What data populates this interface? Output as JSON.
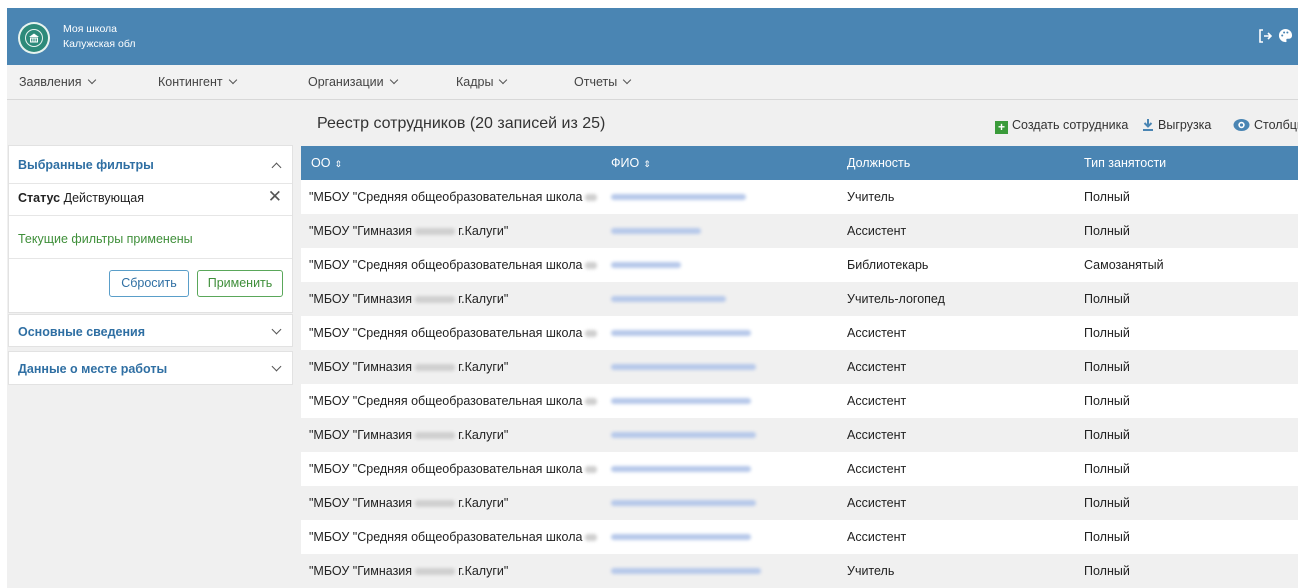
{
  "header": {
    "org_name": "Моя школа",
    "region": "Калужская обл"
  },
  "menu": [
    "Заявления",
    "Контингент",
    "Организации",
    "Кадры",
    "Отчеты"
  ],
  "filters": {
    "selected_title": "Выбранные фильтры",
    "status_label": "Статус",
    "status_value": "Действующая",
    "applied_text": "Текущие фильтры применены",
    "reset_label": "Сбросить",
    "apply_label": "Применить",
    "section_basic": "Основные сведения",
    "section_work": "Данные о месте работы"
  },
  "registry": {
    "title": "Реестр сотрудников (20 записей из 25)",
    "create_label": "Создать сотрудника",
    "export_label": "Выгрузка",
    "columns_label": "Столбцы"
  },
  "table": {
    "headers": [
      "ОО",
      "ФИО",
      "Должность",
      "Тип занятости"
    ],
    "rows": [
      {
        "org_prefix": "\"МБОУ \"Средняя общеобразовательная школа",
        "org_suffix": "",
        "position": "Учитель",
        "employment": "Полный"
      },
      {
        "org_prefix": "\"МБОУ \"Гимназия",
        "org_suffix": "г.Калуги\"",
        "position": "Ассистент",
        "employment": "Полный"
      },
      {
        "org_prefix": "\"МБОУ \"Средняя общеобразовательная школа",
        "org_suffix": "",
        "position": "Библиотекарь",
        "employment": "Самозанятый"
      },
      {
        "org_prefix": "\"МБОУ \"Гимназия",
        "org_suffix": "г.Калуги\"",
        "position": "Учитель-логопед",
        "employment": "Полный"
      },
      {
        "org_prefix": "\"МБОУ \"Средняя общеобразовательная школа",
        "org_suffix": "",
        "position": "Ассистент",
        "employment": "Полный"
      },
      {
        "org_prefix": "\"МБОУ \"Гимназия",
        "org_suffix": "г.Калуги\"",
        "position": "Ассистент",
        "employment": "Полный"
      },
      {
        "org_prefix": "\"МБОУ \"Средняя общеобразовательная школа",
        "org_suffix": "",
        "position": "Ассистент",
        "employment": "Полный"
      },
      {
        "org_prefix": "\"МБОУ \"Гимназия",
        "org_suffix": "г.Калуги\"",
        "position": "Ассистент",
        "employment": "Полный"
      },
      {
        "org_prefix": "\"МБОУ \"Средняя общеобразовательная школа",
        "org_suffix": "",
        "position": "Ассистент",
        "employment": "Полный"
      },
      {
        "org_prefix": "\"МБОУ \"Гимназия",
        "org_suffix": "г.Калуги\"",
        "position": "Ассистент",
        "employment": "Полный"
      },
      {
        "org_prefix": "\"МБОУ \"Средняя общеобразовательная школа",
        "org_suffix": "",
        "position": "Ассистент",
        "employment": "Полный"
      },
      {
        "org_prefix": "\"МБОУ \"Гимназия",
        "org_suffix": "г.Калуги\"",
        "position": "Учитель",
        "employment": "Полный"
      }
    ]
  },
  "icons": {
    "logo": "school-building-icon",
    "logout": "logout-icon",
    "palette": "palette-icon",
    "create": "plus-square-icon",
    "export": "download-icon",
    "columns": "eye-icon",
    "clear": "close-icon"
  },
  "colors": {
    "header": "#4a85b3",
    "accent_link": "#2f6fa3",
    "success_text": "#3f8f3a",
    "plus_green": "#3a9b3a"
  }
}
